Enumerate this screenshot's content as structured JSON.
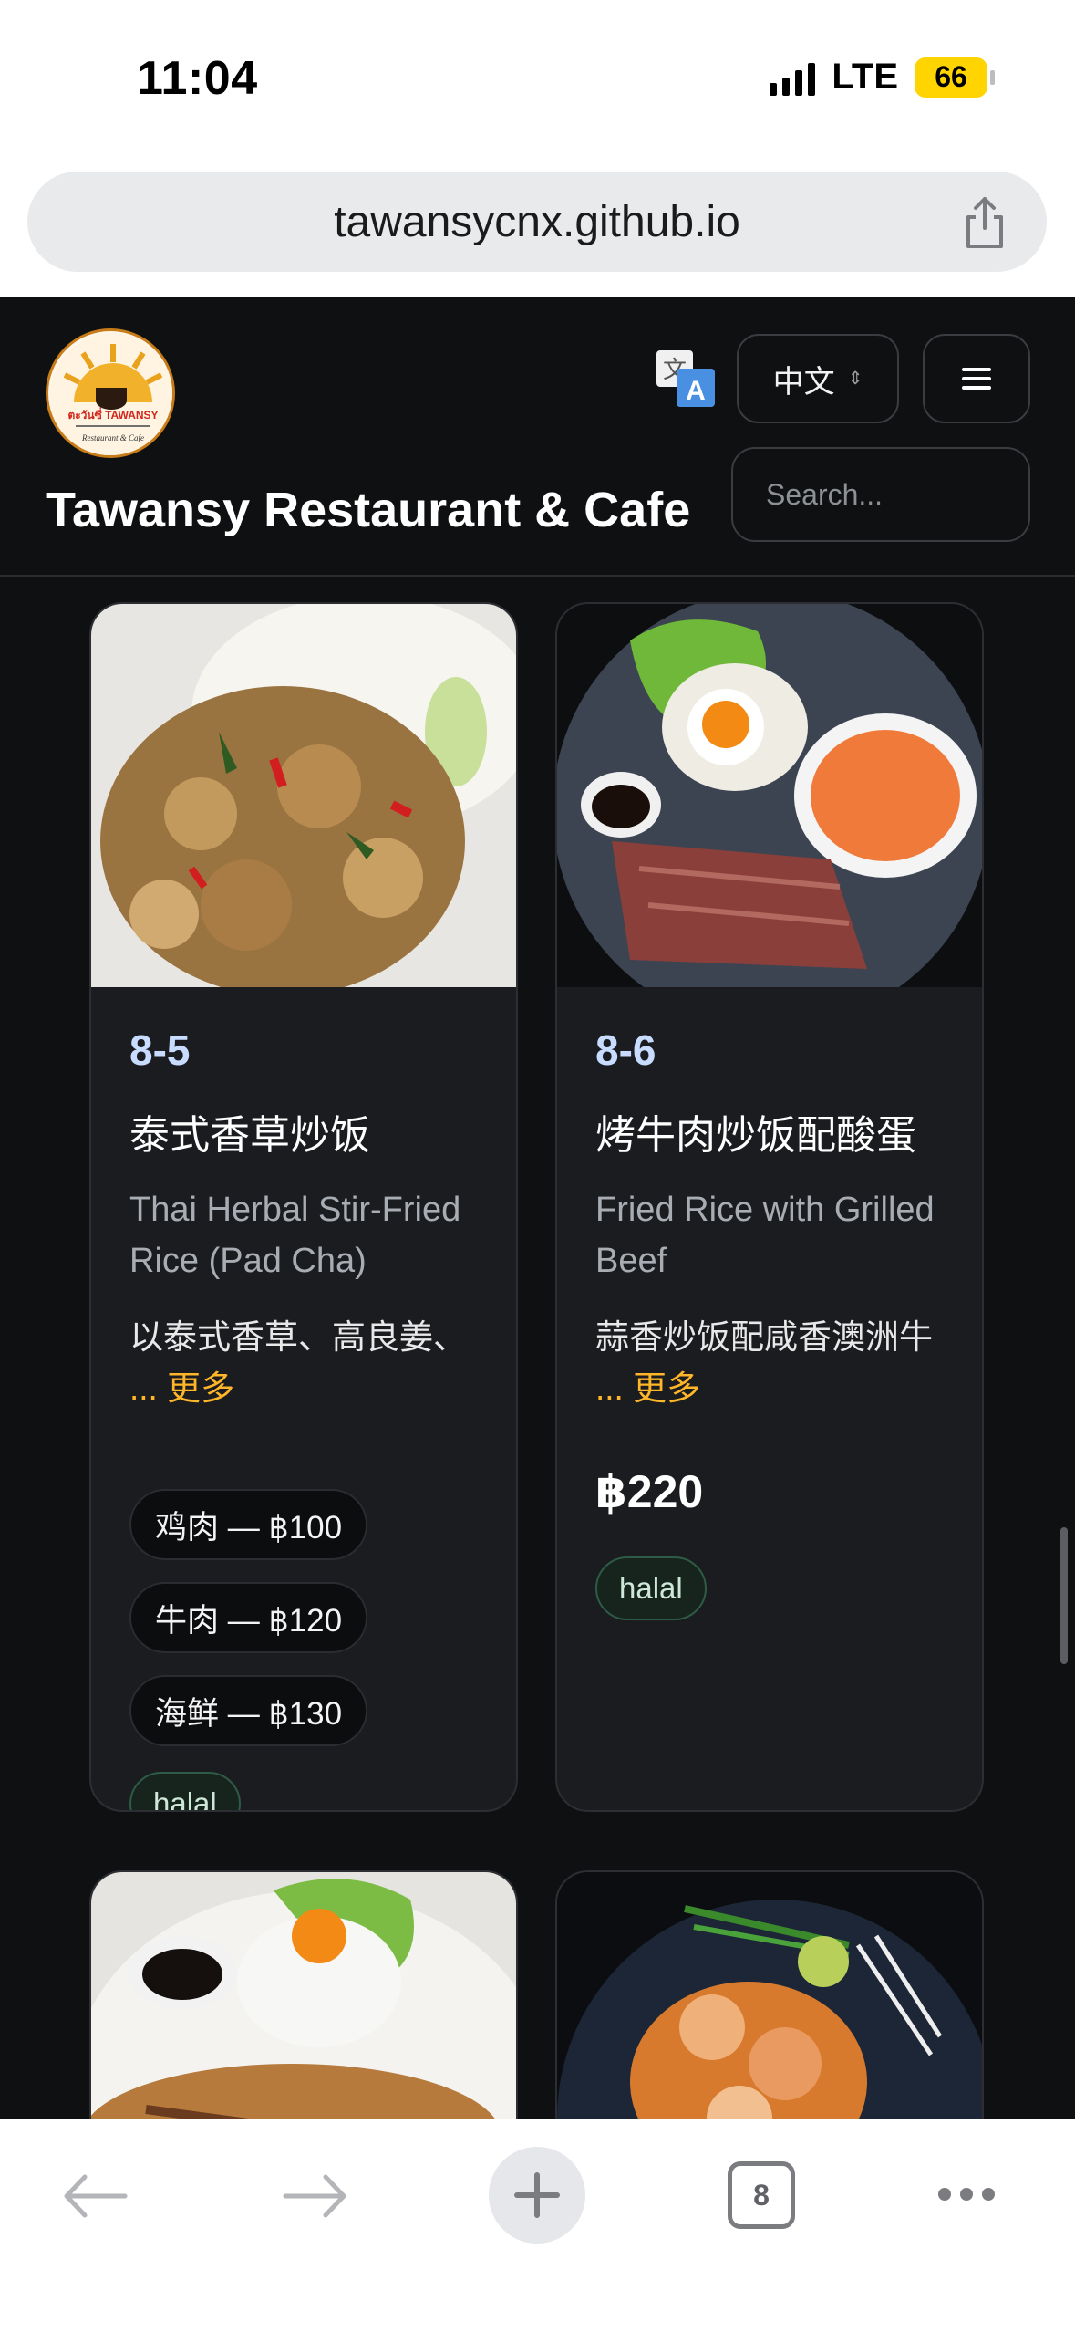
{
  "status_bar": {
    "time": "11:04",
    "network": "LTE",
    "battery": "66"
  },
  "browser": {
    "url": "tawansycnx.github.io",
    "tab_count": "8"
  },
  "header": {
    "title": "Tawansy Restaurant & Cafe",
    "language": "中文",
    "search_placeholder": "Search...",
    "logo_text": "ตะวันซี่ TAWANSY",
    "logo_subtext": "Restaurant & Cafe"
  },
  "menu_items": [
    {
      "code": "8-5",
      "name": "泰式香草炒饭",
      "english": "Thai Herbal Stir-Fried Rice (Pad Cha)",
      "desc": "以泰式香草、高良姜、",
      "more": "... 更多",
      "options": [
        "鸡肉 — ฿100",
        "牛肉 — ฿120",
        "海鲜 — ฿130"
      ],
      "tag": "halal"
    },
    {
      "code": "8-6",
      "name": "烤牛肉炒饭配酸蛋",
      "english": "Fried Rice with Grilled Beef",
      "desc": "蒜香炒饭配咸香澳洲牛",
      "more": "... 更多",
      "price": "฿220",
      "tag": "halal"
    }
  ],
  "colors": {
    "background": "#0f1012",
    "card": "#1b1c1f",
    "accent_code": "#c8dcff",
    "accent_more": "#ffb628",
    "halal_border": "#2d5b46"
  }
}
